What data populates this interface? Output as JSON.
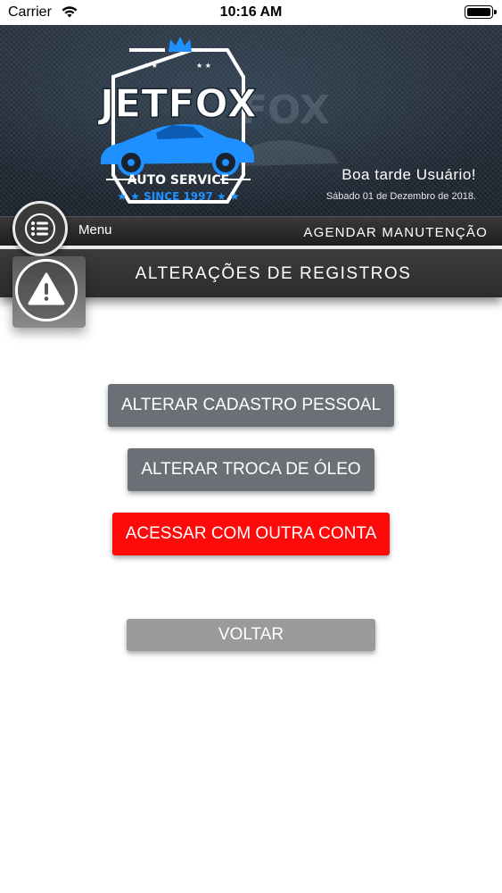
{
  "status_bar": {
    "carrier": "Carrier",
    "time": "10:16 AM"
  },
  "banner": {
    "logo": {
      "brand": "JETFOX",
      "subtitle": "AUTO SERVICE",
      "since": "SINCE 1997"
    },
    "greeting": "Boa tarde Usuário!",
    "date": "Sábado 01 de Dezembro de 2018."
  },
  "nav": {
    "menu_label": "Menu",
    "schedule_label": "AGENDAR MANUTENÇÃO"
  },
  "section": {
    "title": "ALTERAÇÕES DE REGISTROS"
  },
  "actions": {
    "edit_profile": "ALTERAR CADASTRO PESSOAL",
    "edit_oil_change": "ALTERAR TROCA DE ÓLEO",
    "switch_account": "ACESSAR COM OUTRA CONTA",
    "back": "VOLTAR"
  },
  "colors": {
    "grey_button": "#6b7077",
    "red_button": "#ff0a0a",
    "light_button": "#9a9a9a",
    "logo_blue": "#1e90ff"
  },
  "icons": {
    "menu": "list-icon",
    "alert": "warning-icon",
    "wifi": "wifi-icon",
    "battery": "battery-icon"
  }
}
